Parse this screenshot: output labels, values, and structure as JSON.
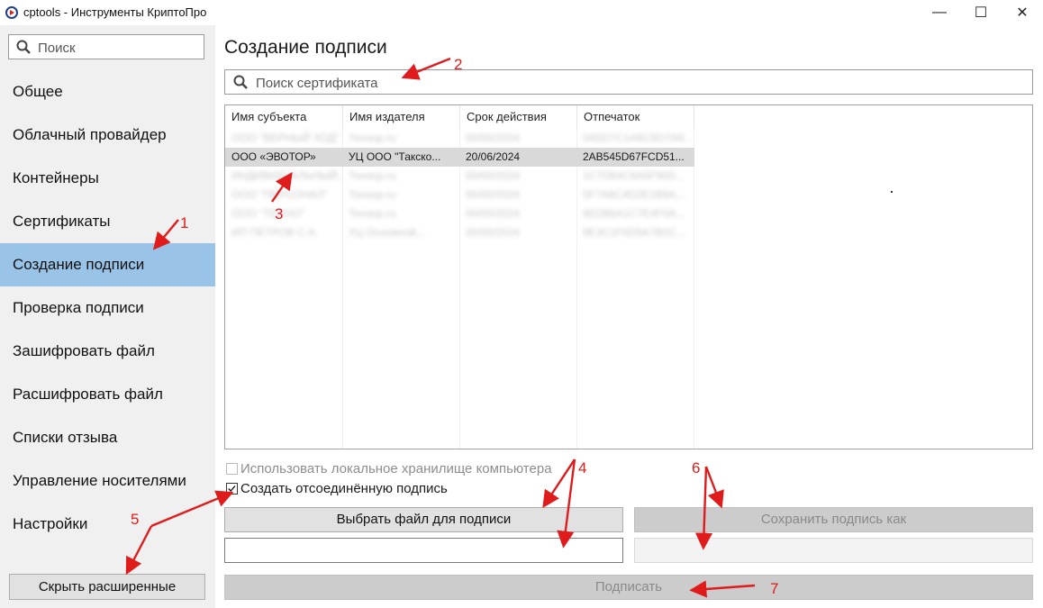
{
  "window": {
    "title": "cptools - Инструменты КриптоПро",
    "minimize": "—",
    "maximize": "☐",
    "close": "✕"
  },
  "sidebar": {
    "search_placeholder": "Поиск",
    "items": [
      {
        "label": "Общее"
      },
      {
        "label": "Облачный провайдер"
      },
      {
        "label": "Контейнеры"
      },
      {
        "label": "Сертификаты"
      },
      {
        "label": "Создание подписи"
      },
      {
        "label": "Проверка подписи"
      },
      {
        "label": "Зашифровать файл"
      },
      {
        "label": "Расшифровать файл"
      },
      {
        "label": "Списки отзыва"
      },
      {
        "label": "Управление носителями"
      },
      {
        "label": "Настройки"
      }
    ],
    "active_index": 4,
    "hide_advanced_label": "Скрыть расширенные"
  },
  "main": {
    "title": "Создание подписи",
    "search_placeholder": "Поиск сертификата",
    "table": {
      "columns": [
        "Имя субъекта",
        "Имя издателя",
        "Срок действия",
        "Отпечаток"
      ],
      "rows": [
        {
          "subject": "ООО \"ВЕРНЫЙ ХОД\"",
          "issuer": "Тензор.ru",
          "validity": "00/00/2024",
          "thumbprint": "0A5D7C1A6C5D7A9...",
          "blurred": true
        },
        {
          "subject": "ООО «ЭВОТОР»",
          "issuer": "УЦ ООО \"Такско...",
          "validity": "20/06/2024",
          "thumbprint": "2AB545D67FCD51...",
          "blurred": false
        },
        {
          "subject": "ИНДИВИДУАЛЬНЫЙ...",
          "issuer": "Тензор.ru",
          "validity": "00/00/2024",
          "thumbprint": "1C7D84C6A5F90D...",
          "blurred": true
        },
        {
          "subject": "ООО \"ПЕРСОНАЛ\"",
          "issuer": "Тензор.ru",
          "validity": "00/00/2024",
          "thumbprint": "5F7A8C4D2E1B9A...",
          "blurred": true
        },
        {
          "subject": "ООО \"ТЕХНО\"",
          "issuer": "Тензор.ru",
          "validity": "00/00/2024",
          "thumbprint": "8D2B6A1C7E4F0A...",
          "blurred": true
        },
        {
          "subject": "ИП ПЕТРОВ С.А.",
          "issuer": "УЦ Основной...",
          "validity": "00/00/2024",
          "thumbprint": "9E3C1F0D5A7B2C...",
          "blurred": true
        }
      ],
      "selected_index": 1
    },
    "use_local_store": {
      "label": "Использовать локальное хранилище компьютера",
      "checked": false,
      "disabled": true
    },
    "detached_signature": {
      "label": "Создать отсоединённую подпись",
      "checked": true
    },
    "choose_file_label": "Выбрать файл для подписи",
    "file_path_value": "",
    "save_signature_label": "Сохранить подпись как",
    "save_path_value": "",
    "sign_label": "Подписать"
  },
  "annotations": [
    "1",
    "2",
    "3",
    "4",
    "5",
    "6",
    "7"
  ],
  "colors": {
    "accent_selected_nav": "#99c4e8",
    "annotation_red": "#e01b1b",
    "selected_row": "#d9d9d9"
  }
}
